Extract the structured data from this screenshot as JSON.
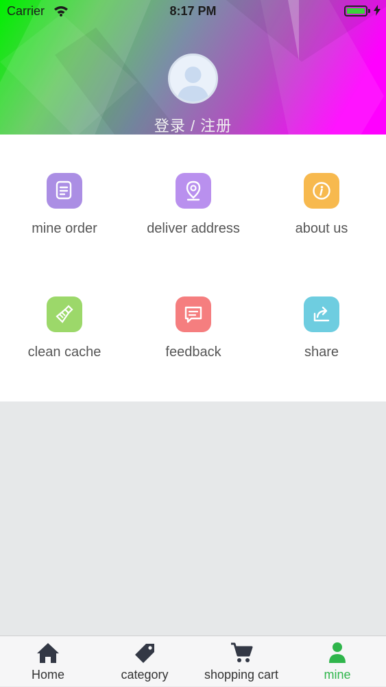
{
  "status_bar": {
    "carrier": "Carrier",
    "time": "8:17 PM"
  },
  "profile": {
    "login_label": "登录 / 注册"
  },
  "menu": [
    {
      "label": "mine order",
      "icon": "order-icon",
      "color": "#ab8ee4"
    },
    {
      "label": "deliver address",
      "icon": "location-pin-icon",
      "color": "#b990ee"
    },
    {
      "label": "about us",
      "icon": "info-icon",
      "color": "#f7b94e"
    },
    {
      "label": "clean cache",
      "icon": "broom-icon",
      "color": "#9cd86a"
    },
    {
      "label": "feedback",
      "icon": "chat-icon",
      "color": "#f57e7f"
    },
    {
      "label": "share",
      "icon": "share-icon",
      "color": "#6ecde0"
    }
  ],
  "tabbar": {
    "tabs": [
      {
        "label": "Home",
        "icon": "home-icon"
      },
      {
        "label": "category",
        "icon": "tag-icon"
      },
      {
        "label": "shopping cart",
        "icon": "cart-icon"
      },
      {
        "label": "mine",
        "icon": "person-icon",
        "active": true
      }
    ],
    "active_color": "#2fb54b"
  }
}
